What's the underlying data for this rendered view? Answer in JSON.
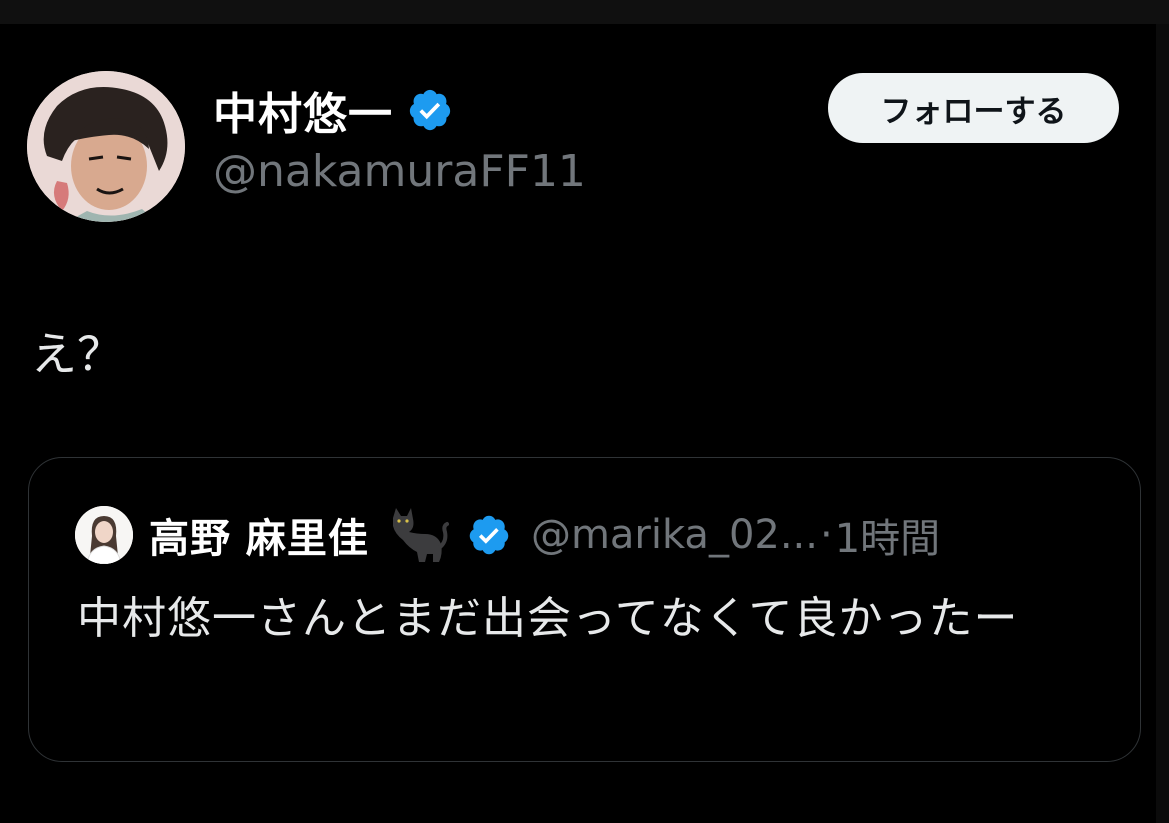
{
  "author": {
    "display_name": "中村悠一",
    "handle": "@nakamuraFF11",
    "verified": true
  },
  "follow_button": {
    "label": "フォローする"
  },
  "tweet": {
    "text": "え？"
  },
  "quoted_tweet": {
    "author_name": "高野 麻里佳",
    "name_emoji_icon": "black-cat-icon",
    "verified": true,
    "handle": "@marika_02...",
    "separator": "·",
    "time": "1時間",
    "text": "中村悠一さんとまだ出会ってなくて良かったー"
  },
  "colors": {
    "background": "#000000",
    "primary_text": "#e7e9ea",
    "secondary_text": "#71767b",
    "verified_badge": "#1d9bf0",
    "follow_button_bg": "#eff3f4",
    "card_border": "#2f3336"
  }
}
